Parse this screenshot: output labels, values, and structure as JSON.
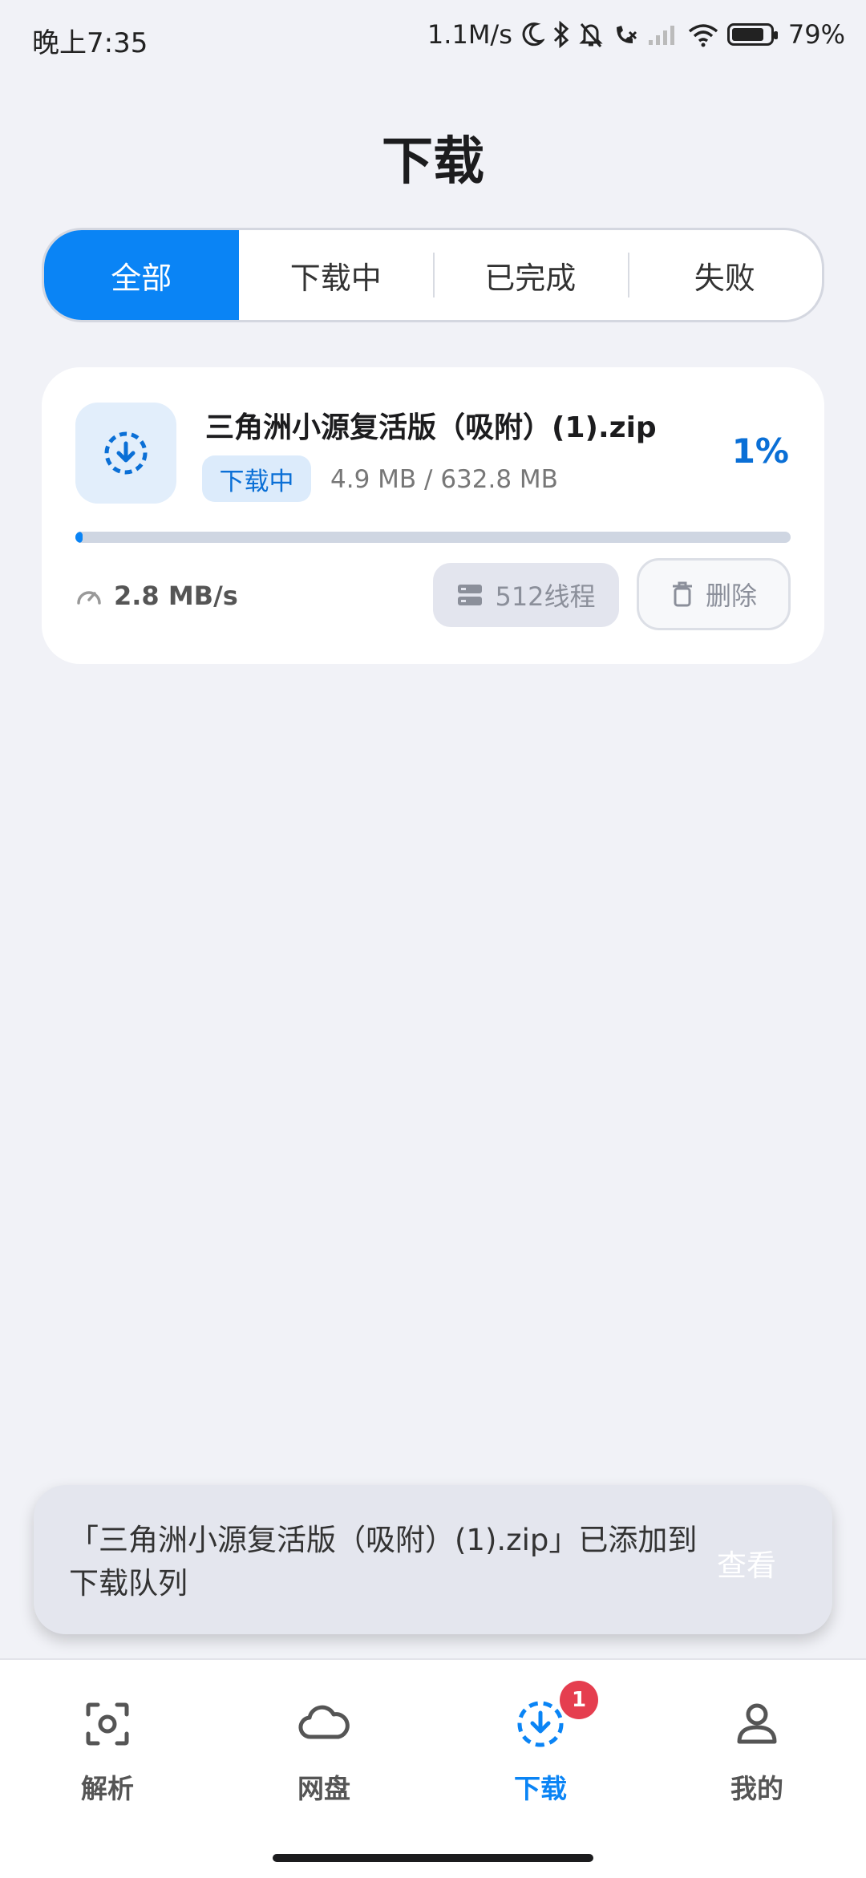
{
  "status_bar": {
    "time": "晚上7:35",
    "net_speed": "1.1M/s",
    "battery": "79%"
  },
  "page": {
    "title": "下载"
  },
  "tabs": [
    {
      "label": "全部",
      "active": true
    },
    {
      "label": "下载中",
      "active": false
    },
    {
      "label": "已完成",
      "active": false
    },
    {
      "label": "失败",
      "active": false
    }
  ],
  "download": {
    "file_name": "三角洲小源复活版（吸附）(1).zip",
    "status": "下载中",
    "size": "4.9 MB / 632.8 MB",
    "percent": "1%",
    "progress": 0.01,
    "speed": "2.8 MB/s",
    "threads_label": "512线程",
    "delete_label": "删除"
  },
  "snackbar": {
    "message": "「三角洲小源复活版（吸附）(1).zip」已添加到下载队列",
    "action": "查看"
  },
  "nav": {
    "items": [
      {
        "label": "解析",
        "icon": "scan-icon"
      },
      {
        "label": "网盘",
        "icon": "cloud-icon"
      },
      {
        "label": "下载",
        "icon": "download-icon",
        "badge": "1"
      },
      {
        "label": "我的",
        "icon": "user-icon"
      }
    ]
  },
  "colors": {
    "accent": "#0a84f5",
    "badge": "#e53e4f",
    "background": "#f1f2f7"
  }
}
